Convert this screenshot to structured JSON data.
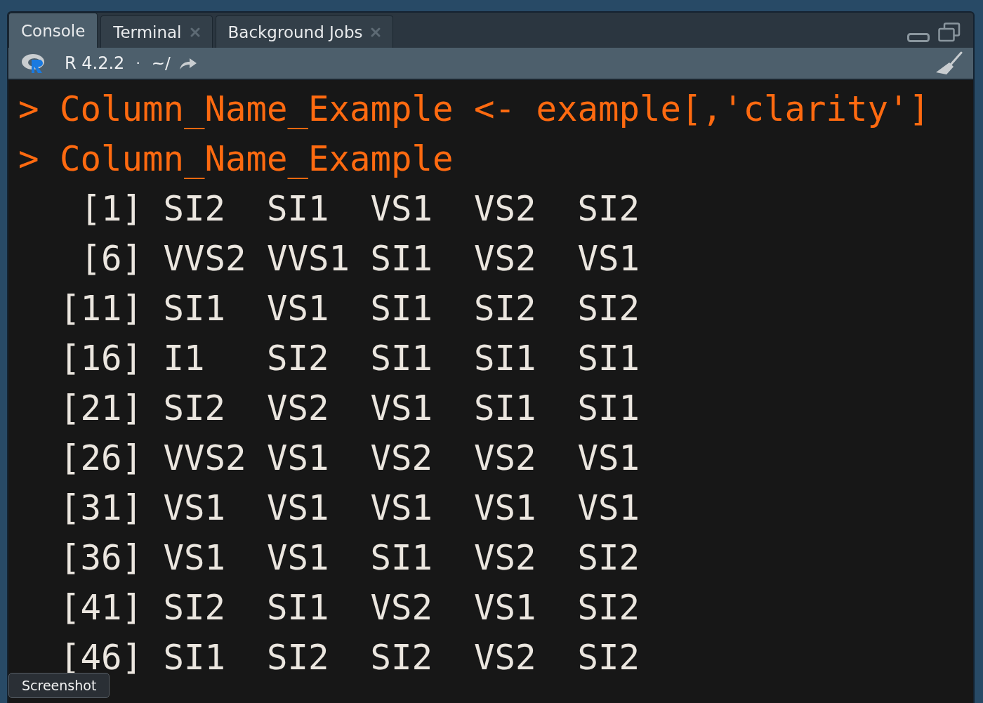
{
  "tabs": [
    {
      "label": "Console",
      "selected": true,
      "closable": false
    },
    {
      "label": "Terminal",
      "selected": false,
      "closable": true
    },
    {
      "label": "Background Jobs",
      "selected": false,
      "closable": true
    }
  ],
  "toolbar": {
    "version": "R 4.2.2",
    "separator": "·",
    "path": "~/"
  },
  "commands": [
    {
      "prompt": ">",
      "code": "Column_Name_Example <- example[,'clarity']"
    },
    {
      "prompt": ">",
      "code": "Column_Name_Example"
    }
  ],
  "output": [
    {
      "index": "[1]",
      "values": [
        "SI2",
        "SI1",
        "VS1",
        "VS2",
        "SI2"
      ]
    },
    {
      "index": "[6]",
      "values": [
        "VVS2",
        "VVS1",
        "SI1",
        "VS2",
        "VS1"
      ]
    },
    {
      "index": "[11]",
      "values": [
        "SI1",
        "VS1",
        "SI1",
        "SI2",
        "SI2"
      ]
    },
    {
      "index": "[16]",
      "values": [
        "I1",
        "SI2",
        "SI1",
        "SI1",
        "SI1"
      ]
    },
    {
      "index": "[21]",
      "values": [
        "SI2",
        "VS2",
        "VS1",
        "SI1",
        "SI1"
      ]
    },
    {
      "index": "[26]",
      "values": [
        "VVS2",
        "VS1",
        "VS2",
        "VS2",
        "VS1"
      ]
    },
    {
      "index": "[31]",
      "values": [
        "VS1",
        "VS1",
        "VS1",
        "VS1",
        "VS1"
      ]
    },
    {
      "index": "[36]",
      "values": [
        "VS1",
        "VS1",
        "SI1",
        "VS2",
        "SI2"
      ]
    },
    {
      "index": "[41]",
      "values": [
        "SI2",
        "SI1",
        "VS2",
        "VS1",
        "SI2"
      ]
    },
    {
      "index": "[46]",
      "values": [
        "SI1",
        "SI2",
        "SI2",
        "VS2",
        "SI2"
      ]
    }
  ],
  "tooltip": "Screenshot"
}
